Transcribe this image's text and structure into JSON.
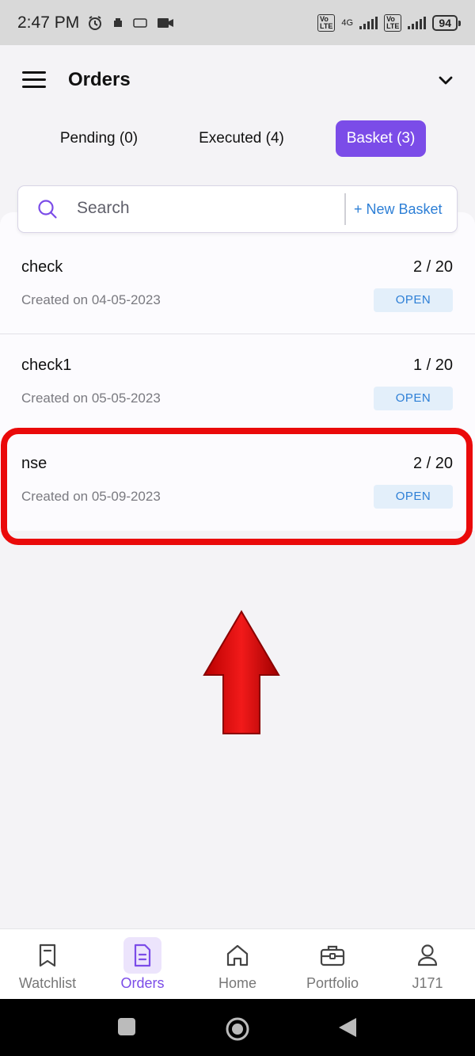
{
  "status_bar": {
    "time": "2:47 PM",
    "network_label": "4G",
    "volte_label": "Vo LTE",
    "battery": "94"
  },
  "header": {
    "title": "Orders"
  },
  "tabs": [
    {
      "label": "Pending (0)",
      "active": false
    },
    {
      "label": "Executed (4)",
      "active": false
    },
    {
      "label": "Basket (3)",
      "active": true
    }
  ],
  "search": {
    "placeholder": "Search",
    "new_basket_label": "+ New Basket"
  },
  "baskets": [
    {
      "name": "check",
      "count": "2 / 20",
      "created": "Created on 04-05-2023",
      "status": "OPEN"
    },
    {
      "name": "check1",
      "count": "1 / 20",
      "created": "Created on 05-05-2023",
      "status": "OPEN"
    },
    {
      "name": "nse",
      "count": "2 / 20",
      "created": "Created on 05-09-2023",
      "status": "OPEN"
    }
  ],
  "bottom_nav": [
    {
      "label": "Watchlist",
      "icon": "bookmark-icon",
      "active": false
    },
    {
      "label": "Orders",
      "icon": "orders-document-icon",
      "active": true
    },
    {
      "label": "Home",
      "icon": "home-icon",
      "active": false
    },
    {
      "label": "Portfolio",
      "icon": "briefcase-icon",
      "active": false
    },
    {
      "label": "J171",
      "icon": "user-icon",
      "active": false
    }
  ],
  "colors": {
    "accent": "#7b4ce8",
    "link": "#2d7fd6",
    "status_bg": "#e3effa",
    "annotation_red": "#ea0a0a"
  }
}
